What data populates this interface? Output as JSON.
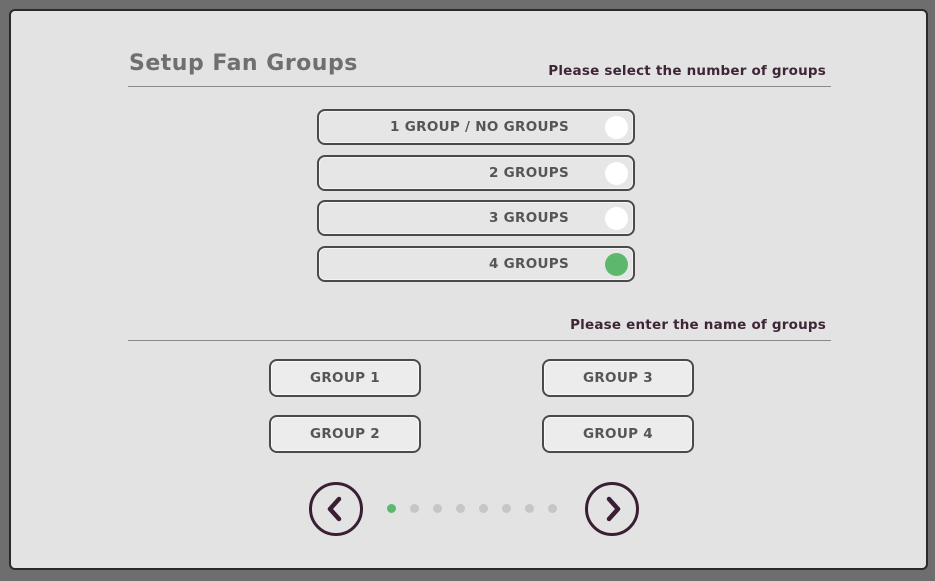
{
  "page": {
    "title": "Setup Fan Groups"
  },
  "number_section": {
    "prompt": "Please select the number of groups",
    "options": [
      {
        "label": "1 GROUP / NO GROUPS",
        "selected": false
      },
      {
        "label": "2 GROUPS",
        "selected": false
      },
      {
        "label": "3 GROUPS",
        "selected": false
      },
      {
        "label": "4 GROUPS",
        "selected": true
      }
    ]
  },
  "names_section": {
    "prompt": "Please enter the name of groups",
    "groups": [
      "GROUP 1",
      "GROUP 2",
      "GROUP 3",
      "GROUP 4"
    ]
  },
  "pagination": {
    "prev_icon": "chevron-left-icon",
    "next_icon": "chevron-right-icon",
    "total_pages": 8,
    "current_page": 1
  },
  "colors": {
    "selected": "#5cb86b",
    "unselected": "#ffffff",
    "accent_dark": "#3a1e33"
  }
}
